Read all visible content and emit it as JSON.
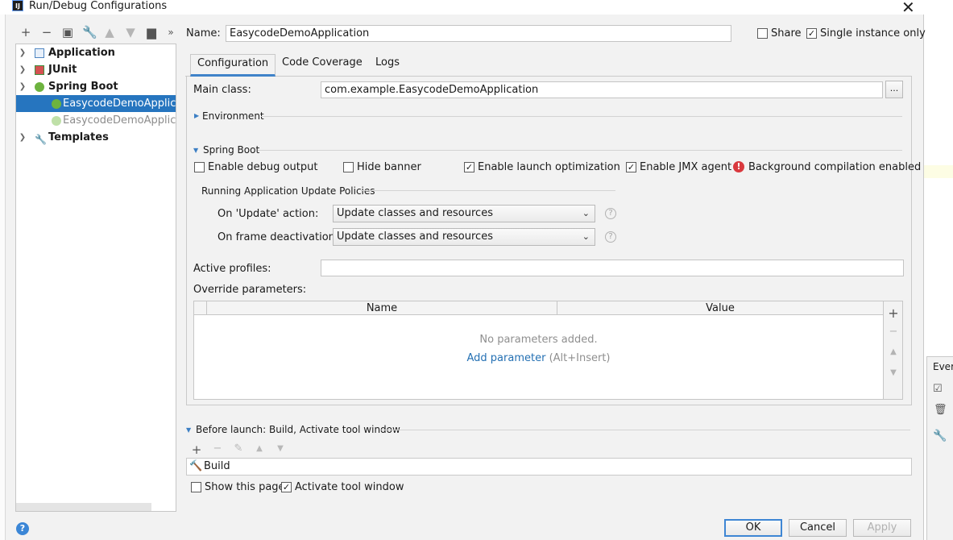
{
  "window": {
    "title": "Run/Debug Configurations"
  },
  "toolbar": {
    "icons": [
      "plus-icon",
      "minus-icon",
      "copy-icon",
      "wrench-icon",
      "arrow-up-icon",
      "arrow-down-icon",
      "folder-icon",
      "more-icon"
    ]
  },
  "tree": {
    "items": [
      {
        "label": "Application",
        "kind": "group"
      },
      {
        "label": "JUnit",
        "kind": "group"
      },
      {
        "label": "Spring Boot",
        "kind": "group"
      },
      {
        "label": "EasycodeDemoApplicati",
        "kind": "config",
        "selected": true
      },
      {
        "label": "EasycodeDemoApplicati",
        "kind": "config"
      },
      {
        "label": "Templates",
        "kind": "group"
      }
    ]
  },
  "header": {
    "name_label": "Name:",
    "name_value": "EasycodeDemoApplication",
    "share_label": "Share",
    "share_checked": false,
    "single_instance_label": "Single instance only",
    "single_instance_checked": true
  },
  "tabs": [
    {
      "label": "Configuration",
      "active": true
    },
    {
      "label": "Code Coverage"
    },
    {
      "label": "Logs"
    }
  ],
  "config": {
    "main_class_label": "Main class:",
    "main_class_value": "com.example.EasycodeDemoApplication",
    "browse_label": "...",
    "environment_label": "Environment",
    "spring_boot_label": "Spring Boot",
    "debug_output_label": "Enable debug output",
    "debug_output_checked": false,
    "hide_banner_label": "Hide banner",
    "hide_banner_checked": false,
    "launch_opt_label": "Enable launch optimization",
    "launch_opt_checked": true,
    "jmx_label": "Enable JMX agent",
    "jmx_checked": true,
    "bg_compile_label": "Background compilation enabled",
    "policies_label": "Running Application Update Policies",
    "on_update_label": "On 'Update' action:",
    "on_update_value": "Update classes and resources",
    "on_frame_label": "On frame deactivation:",
    "on_frame_value": "Update classes and resources",
    "active_profiles_label": "Active profiles:",
    "active_profiles_value": "",
    "override_label": "Override parameters:",
    "table": {
      "columns": [
        "Name",
        "Value"
      ],
      "empty_text": "No parameters added.",
      "add_link": "Add parameter",
      "add_shortcut": "(Alt+Insert)"
    }
  },
  "before_launch": {
    "title": "Before launch: Build, Activate tool window",
    "items": [
      "Build"
    ],
    "show_page_label": "Show this page",
    "show_page_checked": false,
    "activate_label": "Activate tool window",
    "activate_checked": true
  },
  "buttons": {
    "ok": "OK",
    "cancel": "Cancel",
    "apply": "Apply",
    "help": "?"
  },
  "background": {
    "panel_label": "Ever"
  },
  "colors": {
    "selection": "#2675bf",
    "accent": "#4083c9",
    "link": "#2470b3",
    "error": "#d9393e"
  }
}
